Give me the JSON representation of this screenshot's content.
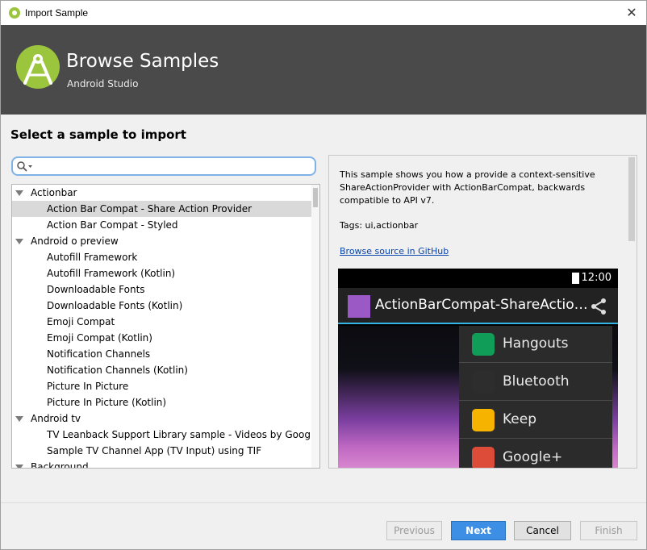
{
  "window": {
    "title": "Import Sample",
    "close_glyph": "✕"
  },
  "banner": {
    "title": "Browse Samples",
    "subtitle": "Android Studio"
  },
  "main": {
    "heading": "Select a sample to import",
    "search": {
      "value": "",
      "placeholder": ""
    }
  },
  "tree": {
    "rows": [
      {
        "type": "category",
        "label": "Actionbar"
      },
      {
        "type": "item",
        "label": "Action Bar Compat - Share Action Provider",
        "selected": true
      },
      {
        "type": "item",
        "label": "Action Bar Compat - Styled"
      },
      {
        "type": "category",
        "label": "Android o preview"
      },
      {
        "type": "item",
        "label": "Autofill Framework"
      },
      {
        "type": "item",
        "label": "Autofill Framework (Kotlin)"
      },
      {
        "type": "item",
        "label": "Downloadable Fonts"
      },
      {
        "type": "item",
        "label": "Downloadable Fonts (Kotlin)"
      },
      {
        "type": "item",
        "label": "Emoji Compat"
      },
      {
        "type": "item",
        "label": "Emoji Compat (Kotlin)"
      },
      {
        "type": "item",
        "label": "Notification Channels"
      },
      {
        "type": "item",
        "label": "Notification Channels (Kotlin)"
      },
      {
        "type": "item",
        "label": "Picture In Picture"
      },
      {
        "type": "item",
        "label": "Picture In Picture (Kotlin)"
      },
      {
        "type": "category",
        "label": "Android tv"
      },
      {
        "type": "item",
        "label": "TV Leanback Support Library sample - Videos by Google"
      },
      {
        "type": "item",
        "label": "Sample TV Channel App (TV Input) using TIF"
      },
      {
        "type": "category",
        "label": "Background"
      }
    ]
  },
  "details": {
    "description": "This sample shows you how a provide a context-sensitive ShareActionProvider with ActionBarCompat, backwards compatible to API v7.",
    "tags": "Tags: ui,actionbar",
    "github_link": "Browse source in GitHub",
    "preview": {
      "time": "12:00",
      "app_title": "ActionBarCompat-ShareActio…",
      "menu": [
        {
          "label": "Hangouts",
          "icon": "hangouts-icon",
          "color": "#0f9d58"
        },
        {
          "label": "Bluetooth",
          "icon": "bluetooth-icon",
          "color": "#2d2d2d"
        },
        {
          "label": "Keep",
          "icon": "keep-icon",
          "color": "#f6b400"
        },
        {
          "label": "Google+",
          "icon": "google-plus-icon",
          "color": "#dd4b39"
        }
      ]
    }
  },
  "footer": {
    "previous": "Previous",
    "next": "Next",
    "cancel": "Cancel",
    "finish": "Finish"
  },
  "colors": {
    "banner_bg": "#4a4a4a",
    "selection": "#d9d9d9",
    "primary_button": "#3d8ee5",
    "android_green": "#9bc53d"
  }
}
